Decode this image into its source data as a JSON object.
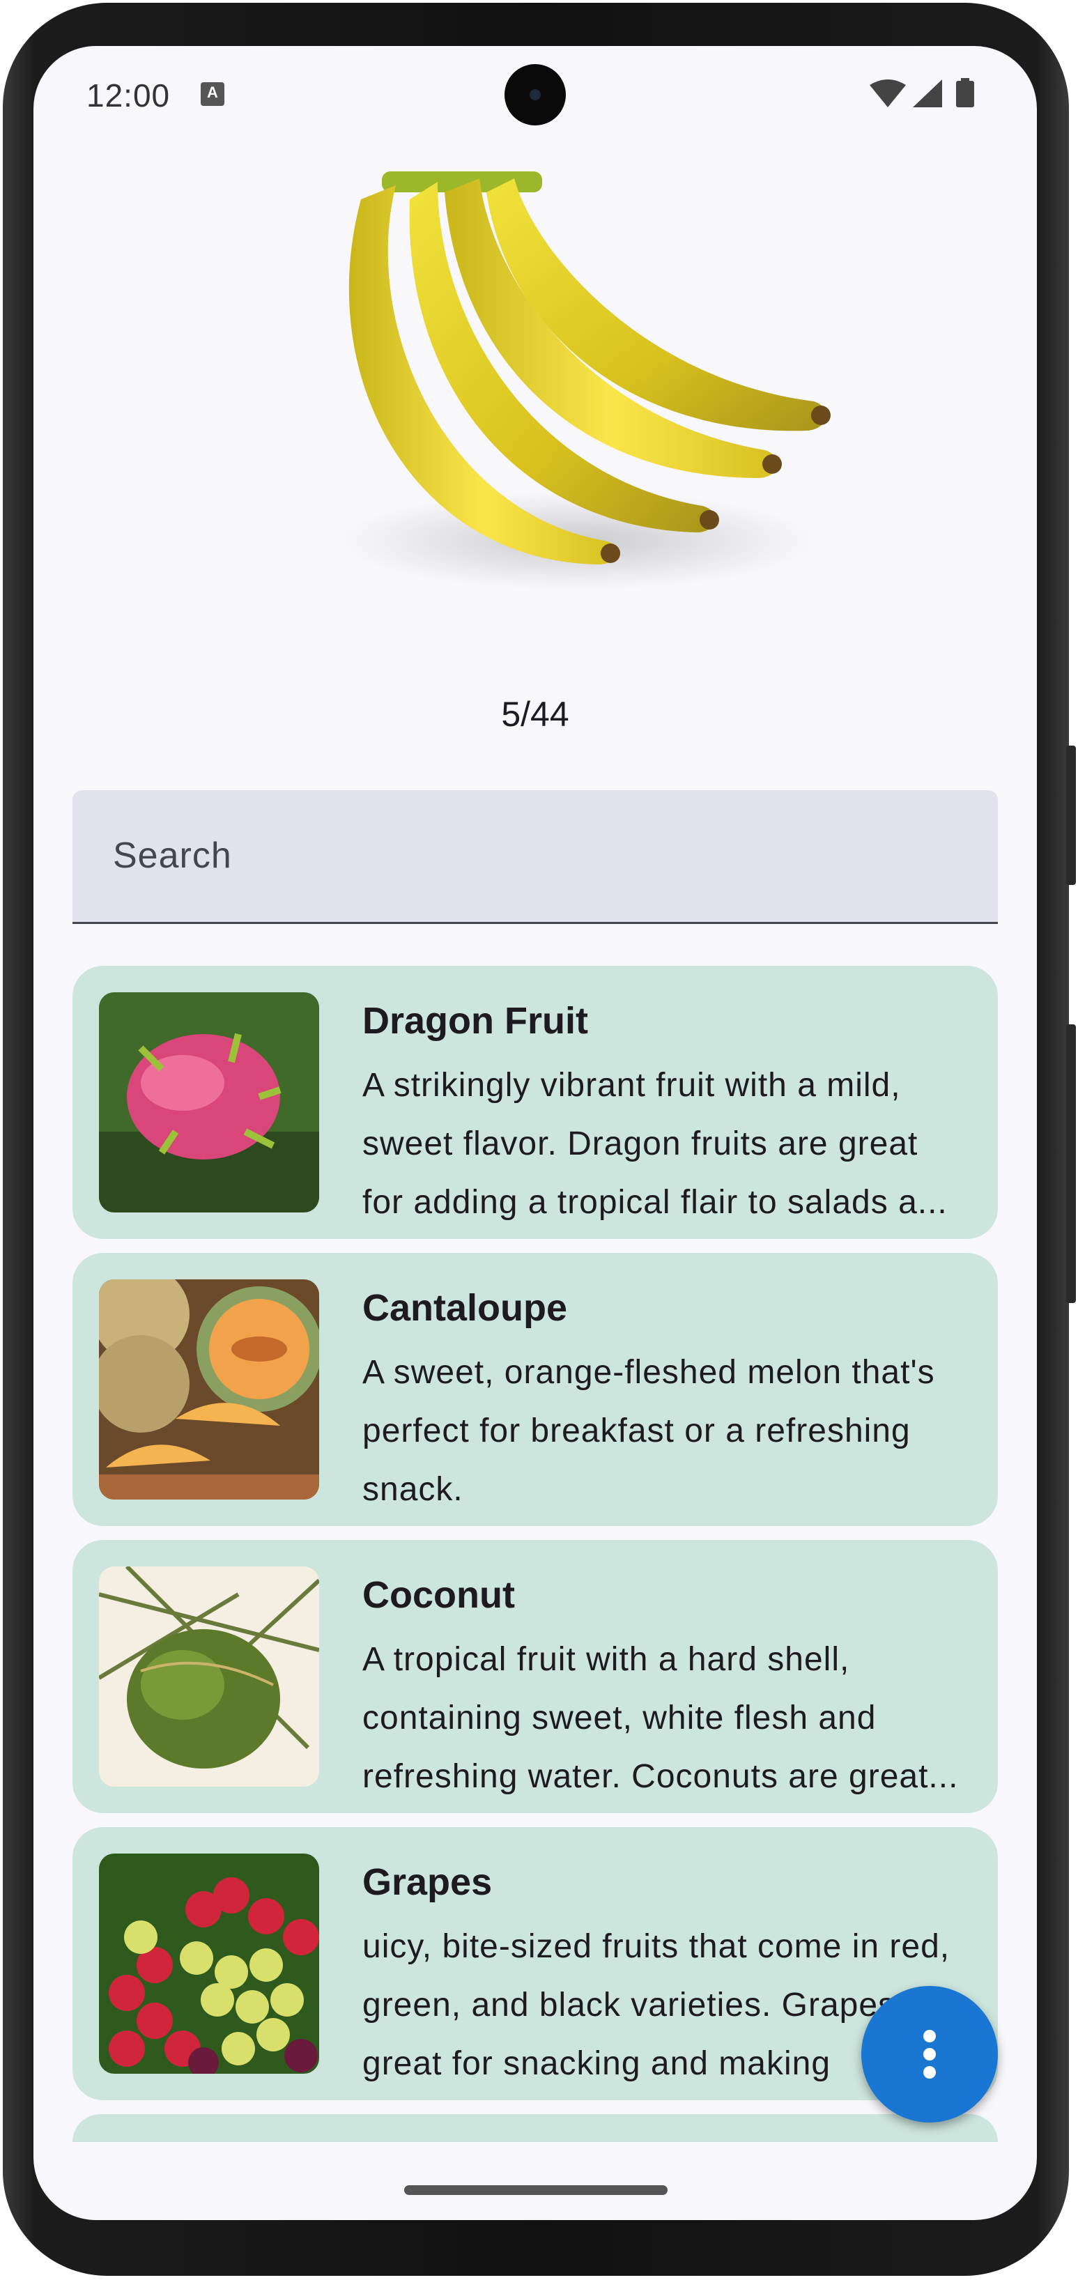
{
  "status_bar": {
    "time": "12:00",
    "indicator": "A",
    "icons": [
      "wifi-icon",
      "signal-icon",
      "battery-icon"
    ]
  },
  "hero": {
    "image": "banana-image",
    "counter": "5/44"
  },
  "search": {
    "placeholder": "Search"
  },
  "fruits": [
    {
      "name": "Dragon Fruit",
      "image": "dragon-fruit-thumbnail",
      "lines": [
        "A strikingly vibrant fruit with a mild,",
        "sweet flavor. Dragon fruits are great",
        "for adding a tropical flair to salads a..."
      ]
    },
    {
      "name": "Cantaloupe",
      "image": "cantaloupe-thumbnail",
      "lines": [
        "A sweet, orange-fleshed melon that's",
        "perfect for breakfast or a refreshing",
        "snack."
      ]
    },
    {
      "name": "Coconut",
      "image": "coconut-thumbnail",
      "lines": [
        "A tropical fruit with a hard shell,",
        "containing sweet, white flesh and",
        "refreshing water. Coconuts are great..."
      ]
    },
    {
      "name": "Grapes",
      "image": "grapes-thumbnail",
      "lines": [
        "uicy, bite-sized fruits that come in red,",
        "green, and black varieties. Grapes are",
        "great for snacking and making"
      ]
    }
  ],
  "fab": {
    "icon": "more-vert-icon"
  },
  "colors": {
    "card": "#cce5dd",
    "fab": "#1976d2",
    "search": "#e1e2ec",
    "background": "#f8f8fc"
  }
}
